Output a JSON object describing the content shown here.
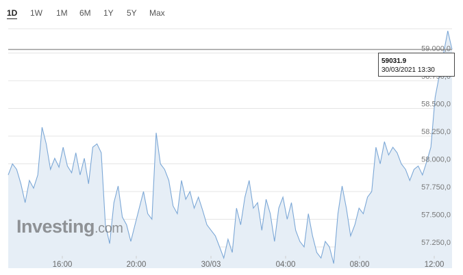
{
  "tabs": [
    {
      "label": "1D",
      "active": true
    },
    {
      "label": "1W",
      "active": false
    },
    {
      "label": "1M",
      "active": false
    },
    {
      "label": "6M",
      "active": false
    },
    {
      "label": "1Y",
      "active": false
    },
    {
      "label": "5Y",
      "active": false
    },
    {
      "label": "Max",
      "active": false
    }
  ],
  "tooltip": {
    "value": "59031.9",
    "datetime": "30/03/2021 13:30"
  },
  "logo": {
    "brand": "Investing",
    "tld": ".com"
  },
  "colors": {
    "line": "#7ba7d6",
    "fill": "#e6eef6",
    "grid": "#e4e4e4",
    "refline": "#9a9a9a"
  },
  "chart_data": {
    "type": "area",
    "x_tick_labels": [
      "16:00",
      "20:00",
      "30/03",
      "04:00",
      "08:00",
      "12:00"
    ],
    "y_tick_labels": [
      "57.250,0",
      "57.500,0",
      "57.750,0",
      "58.000,0",
      "58.250,0",
      "58.500,0",
      "58.750,0",
      "59.000,0"
    ],
    "ylim": [
      57080,
      59200
    ],
    "reference_value": 59031.9,
    "grid": true,
    "values": [
      57900,
      58000,
      57950,
      57820,
      57650,
      57850,
      57780,
      57900,
      58330,
      58180,
      57950,
      58050,
      57970,
      58150,
      57980,
      57920,
      58100,
      57900,
      58050,
      57820,
      58150,
      58180,
      58100,
      57450,
      57280,
      57650,
      57800,
      57520,
      57450,
      57300,
      57450,
      57600,
      57750,
      57550,
      57500,
      58280,
      58000,
      57950,
      57850,
      57620,
      57550,
      57850,
      57680,
      57750,
      57600,
      57700,
      57580,
      57450,
      57400,
      57350,
      57250,
      57150,
      57320,
      57200,
      57600,
      57450,
      57700,
      57850,
      57600,
      57650,
      57400,
      57680,
      57550,
      57300,
      57600,
      57700,
      57500,
      57650,
      57400,
      57300,
      57250,
      57550,
      57350,
      57200,
      57150,
      57300,
      57250,
      57100,
      57550,
      57800,
      57600,
      57350,
      57450,
      57600,
      57550,
      57700,
      57750,
      58150,
      58000,
      58200,
      58080,
      58150,
      58100,
      58000,
      57950,
      57850,
      57950,
      57980,
      57900,
      58020,
      58150,
      58600,
      58800,
      59000,
      59200,
      59031.9
    ]
  }
}
